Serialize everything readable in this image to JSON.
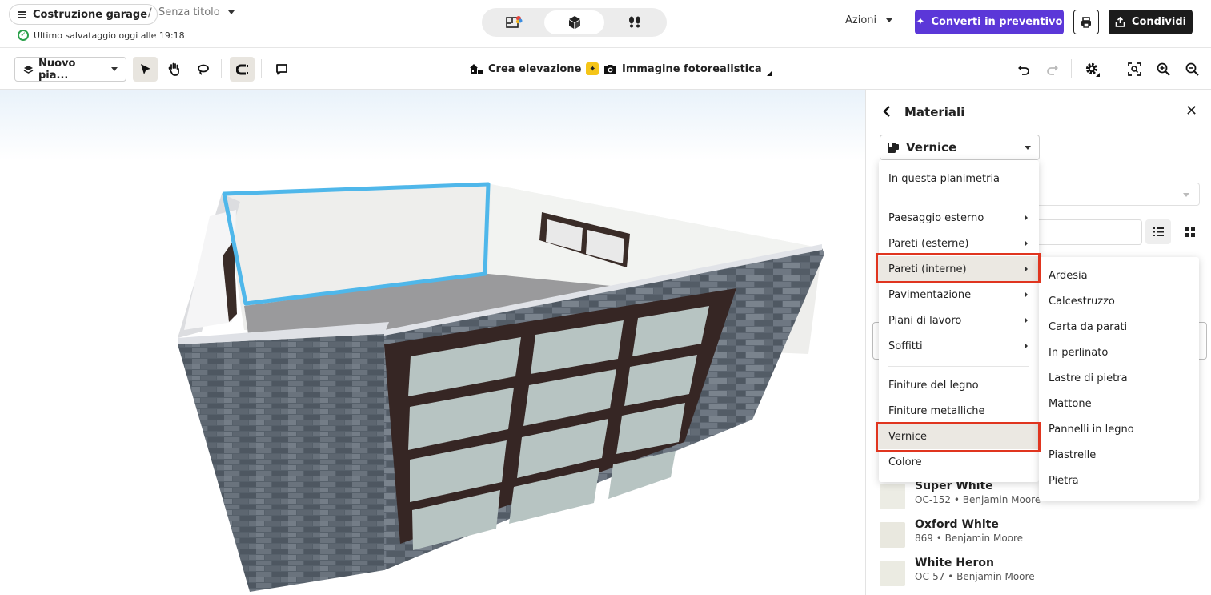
{
  "header": {
    "project_name": "Costruzione garage",
    "separator": "/",
    "document_title": "Senza titolo",
    "save_status": "Ultimo salvataggio oggi alle 19:18",
    "actions_label": "Azioni",
    "convert_label": "Converti in preventivo",
    "share_label": "Condividi",
    "view_modes": [
      "2D",
      "3D",
      "Walkthrough"
    ],
    "active_view_mode": "3D",
    "accent_color": "#5b37d8"
  },
  "toolbar": {
    "plan_select_label": "Nuovo pia...",
    "elevation_label": "Crea elevazione",
    "photoreal_label": "Immagine fotorealistica"
  },
  "panel": {
    "title": "Materiali",
    "category_select": "Vernice",
    "swatches": [
      {
        "name": "Super White",
        "code": "OC-152 • Benjamin Moore",
        "color": "#ecece4"
      },
      {
        "name": "Oxford White",
        "code": "869 • Benjamin Moore",
        "color": "#e9e8df"
      },
      {
        "name": "White Heron",
        "code": "OC-57 • Benjamin Moore",
        "color": "#ebebe2"
      }
    ]
  },
  "menu": {
    "items": [
      {
        "label": "In questa planimetria",
        "submenu": false
      },
      {
        "label": "Paesaggio esterno",
        "submenu": true
      },
      {
        "label": "Pareti (esterne)",
        "submenu": true
      },
      {
        "label": "Pareti (interne)",
        "submenu": true
      },
      {
        "label": "Pavimentazione",
        "submenu": true
      },
      {
        "label": "Piani di lavoro",
        "submenu": true
      },
      {
        "label": "Soffitti",
        "submenu": true
      },
      {
        "label": "Finiture del legno",
        "submenu": false
      },
      {
        "label": "Finiture metalliche",
        "submenu": false
      },
      {
        "label": "Vernice",
        "submenu": false
      },
      {
        "label": "Colore",
        "submenu": false
      }
    ],
    "highlighted": [
      "Pareti (interne)",
      "Vernice"
    ],
    "highlight_color": "#e0351f"
  },
  "submenu": {
    "items": [
      "Ardesia",
      "Calcestruzzo",
      "Carta da parati",
      "In perlinato",
      "Lastre di pietra",
      "Mattone",
      "Pannelli in legno",
      "Piastrelle",
      "Pietra"
    ]
  }
}
